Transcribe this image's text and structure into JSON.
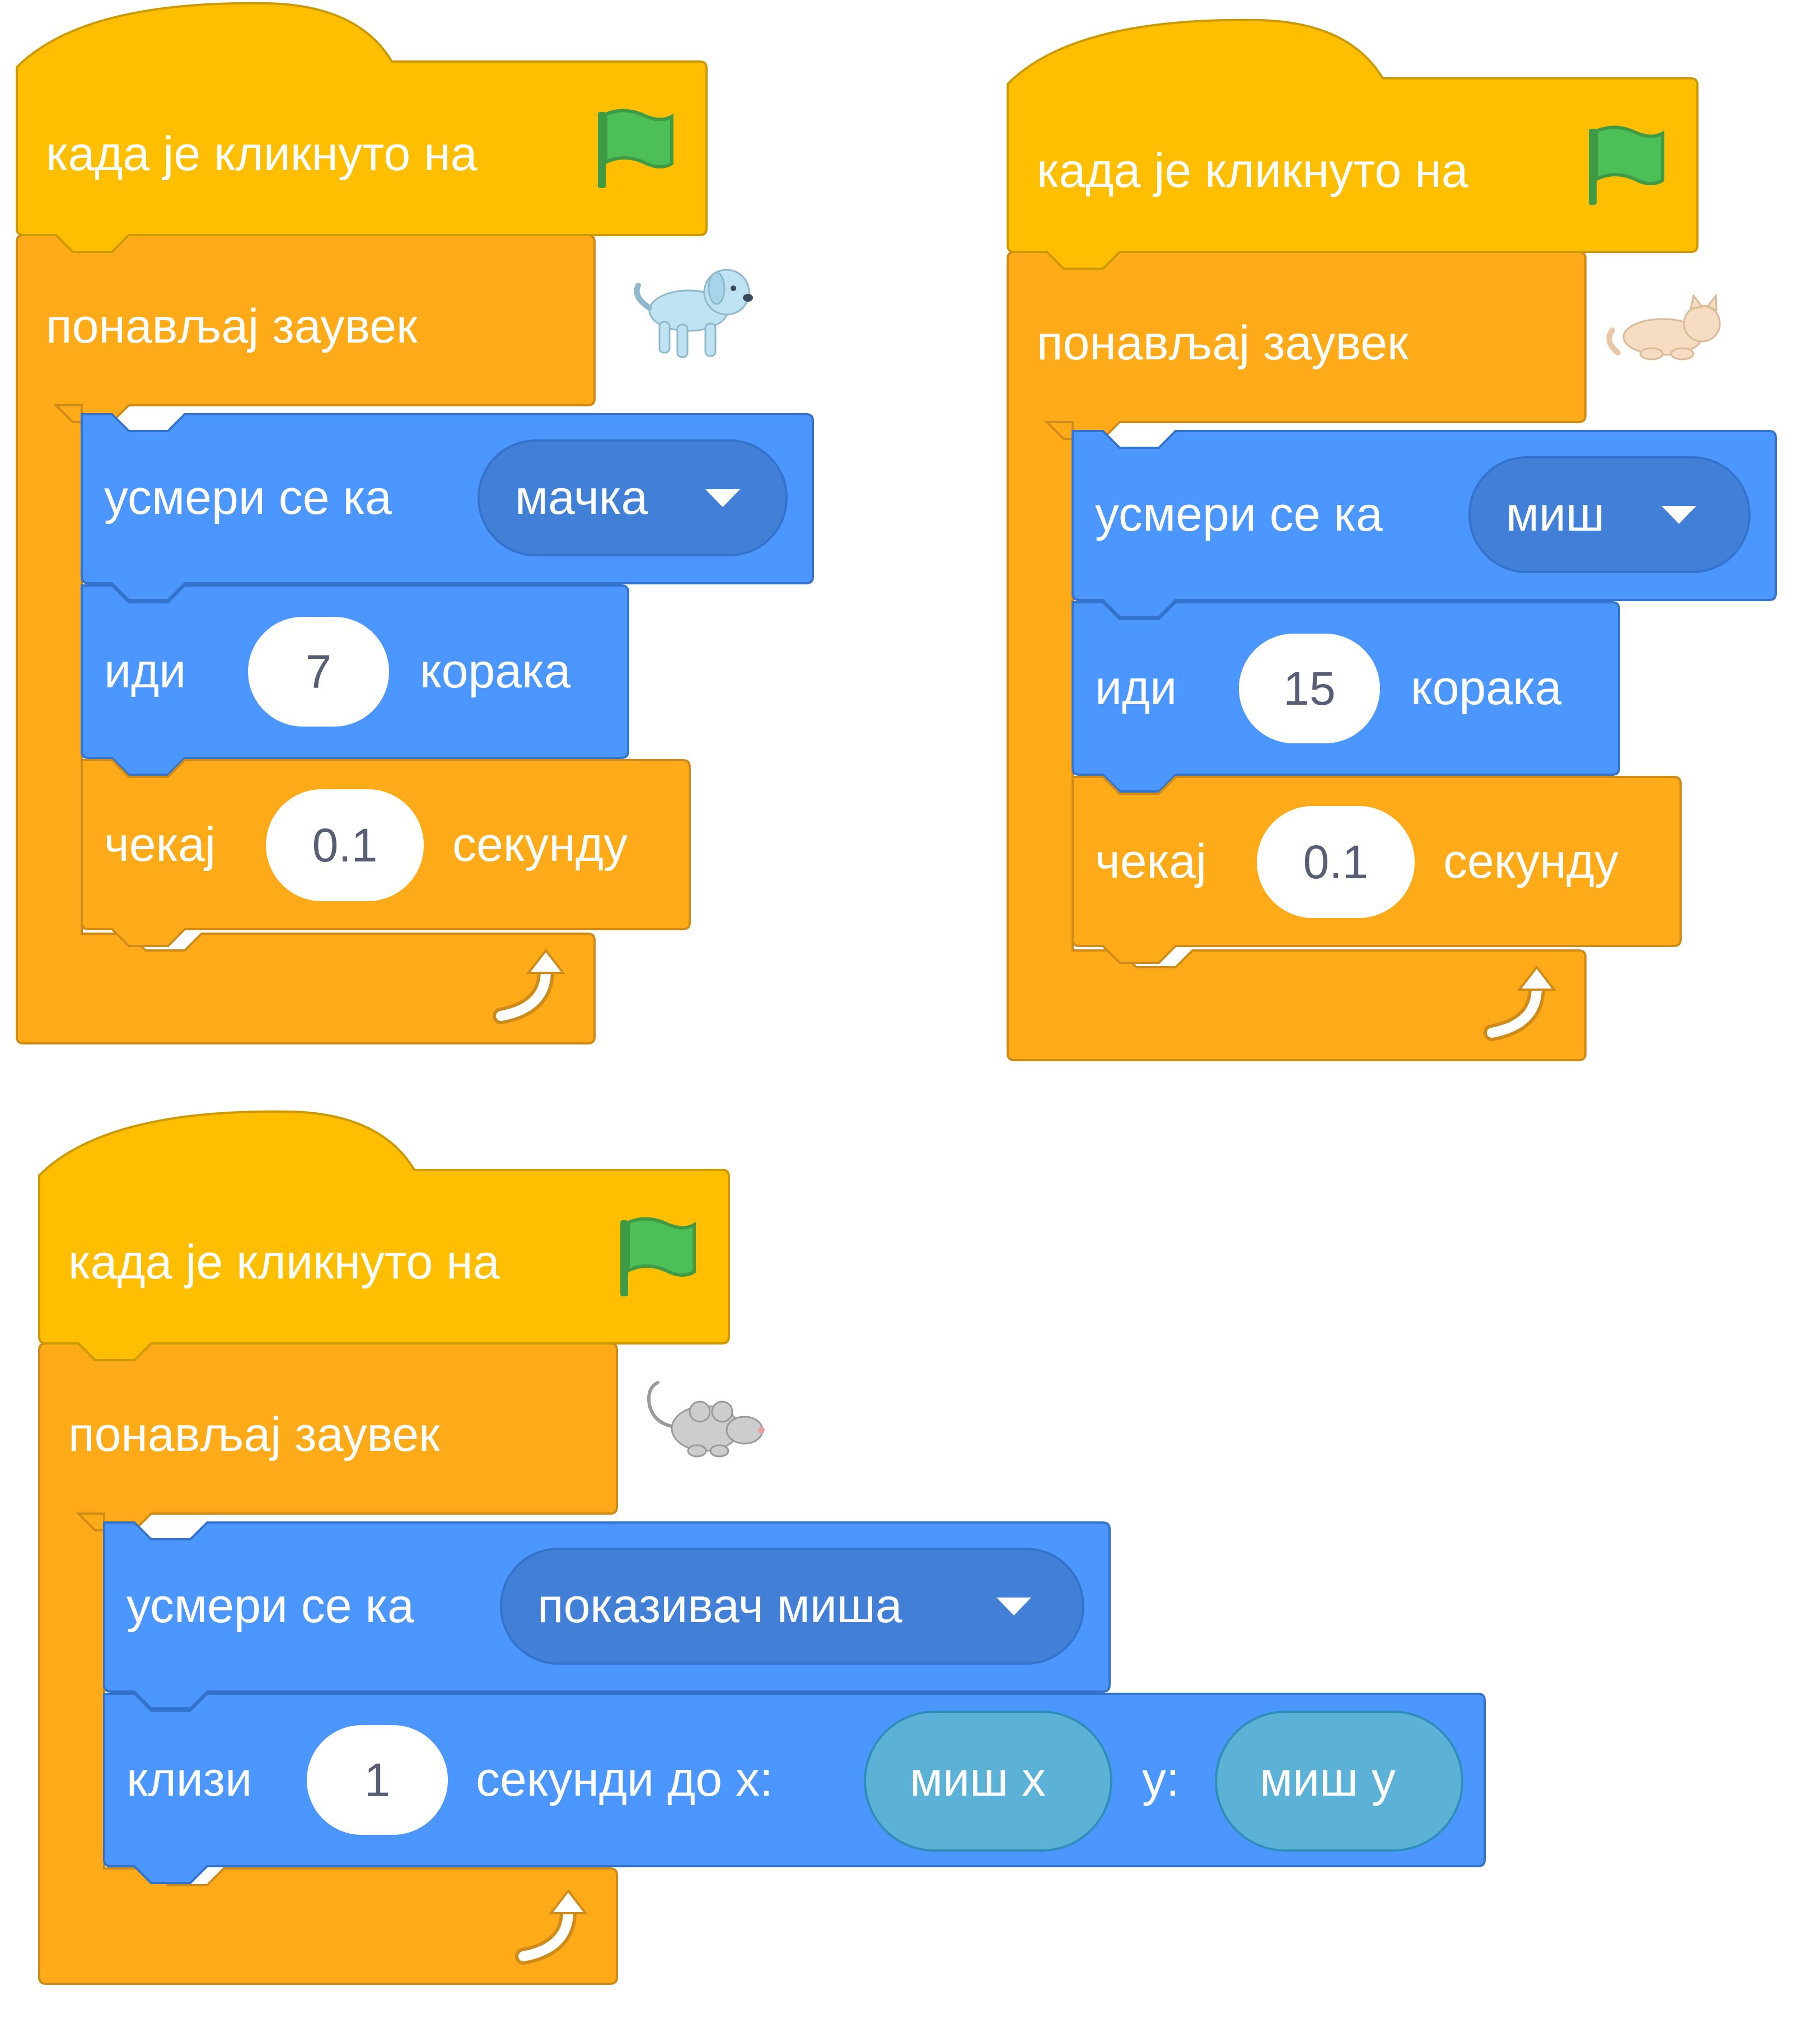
{
  "colors": {
    "events": "#FFBF00",
    "events_border": "#CC9900",
    "control": "#FFAB19",
    "control_border": "#CF8B17",
    "motion": "#4C97FF",
    "motion_border": "#3373CC",
    "sensing": "#5CB1D6",
    "sensing_border": "#2E8EB8",
    "text_light": "#FFFFFF",
    "text_dark": "#575E75",
    "flag": "#4CBF56"
  },
  "scripts": [
    {
      "sprite_icon": "dog-sprite-icon",
      "hat_label": "када је кликнуто на",
      "loop_label": "понављај заувек",
      "point_label": "усмери се ка",
      "point_target": "мачка",
      "move_label": "иди",
      "move_steps": "7",
      "move_unit": "корака",
      "wait_label": "чекај",
      "wait_value": "0.1",
      "wait_unit": "секунду"
    },
    {
      "sprite_icon": "cat-sprite-icon",
      "hat_label": "када је кликнуто на",
      "loop_label": "понављај заувек",
      "point_label": "усмери се ка",
      "point_target": "миш",
      "move_label": "иди",
      "move_steps": "15",
      "move_unit": "корака",
      "wait_label": "чекај",
      "wait_value": "0.1",
      "wait_unit": "секунду"
    },
    {
      "sprite_icon": "mouse-sprite-icon",
      "hat_label": "када је кликнуто на",
      "loop_label": "понављај заувек",
      "point_label": "усмери се ка",
      "point_target": "показивач миша",
      "glide_label": "клизи",
      "glide_secs": "1",
      "glide_mid": "секунди до x:",
      "glide_x": "миш x",
      "glide_y_label": "y:",
      "glide_y": "миш y"
    }
  ]
}
